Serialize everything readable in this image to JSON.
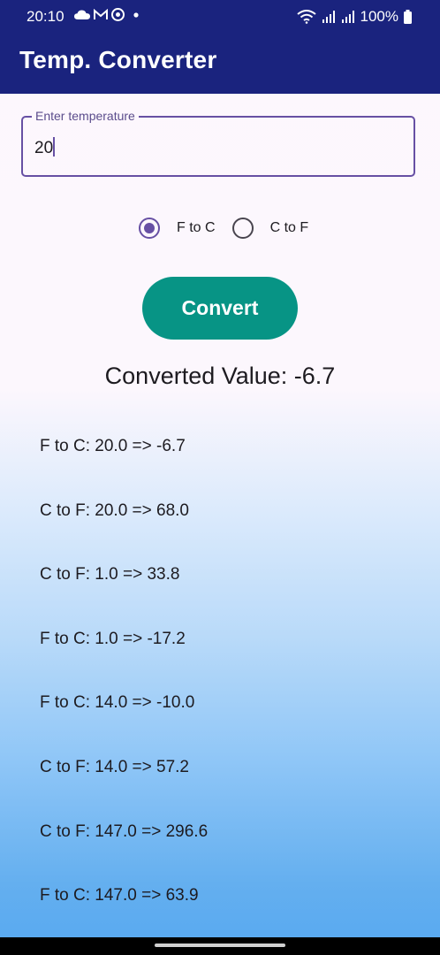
{
  "status_bar": {
    "time": "20:10",
    "battery": "100%",
    "icons": [
      "cloud-icon",
      "gmail-icon",
      "chrome-icon",
      "dot-icon",
      "wifi-icon",
      "signal-icon",
      "signal-icon",
      "battery-icon"
    ]
  },
  "app_bar": {
    "title": "Temp. Converter",
    "color": "#1a237e"
  },
  "input": {
    "label": "Enter temperature",
    "value": "20"
  },
  "conversion_mode": {
    "options": [
      {
        "label": "F to C",
        "selected": true
      },
      {
        "label": "C to F",
        "selected": false
      }
    ]
  },
  "convert_button": {
    "label": "Convert",
    "color": "#079485"
  },
  "result": {
    "text": "Converted Value: -6.7"
  },
  "history": [
    "F to C: 20.0 => -6.7",
    "C to F: 20.0 => 68.0",
    "C to F: 1.0 => 33.8",
    "F to C: 1.0 => -17.2",
    "F to C: 14.0 => -10.0",
    "C to F: 14.0 => 57.2",
    "C to F: 147.0 => 296.6",
    "F to C: 147.0 => 63.9"
  ],
  "colors": {
    "accent": "#6750a4",
    "gradient_top": "#fdf7fd",
    "gradient_bottom": "#5aaaf0"
  }
}
